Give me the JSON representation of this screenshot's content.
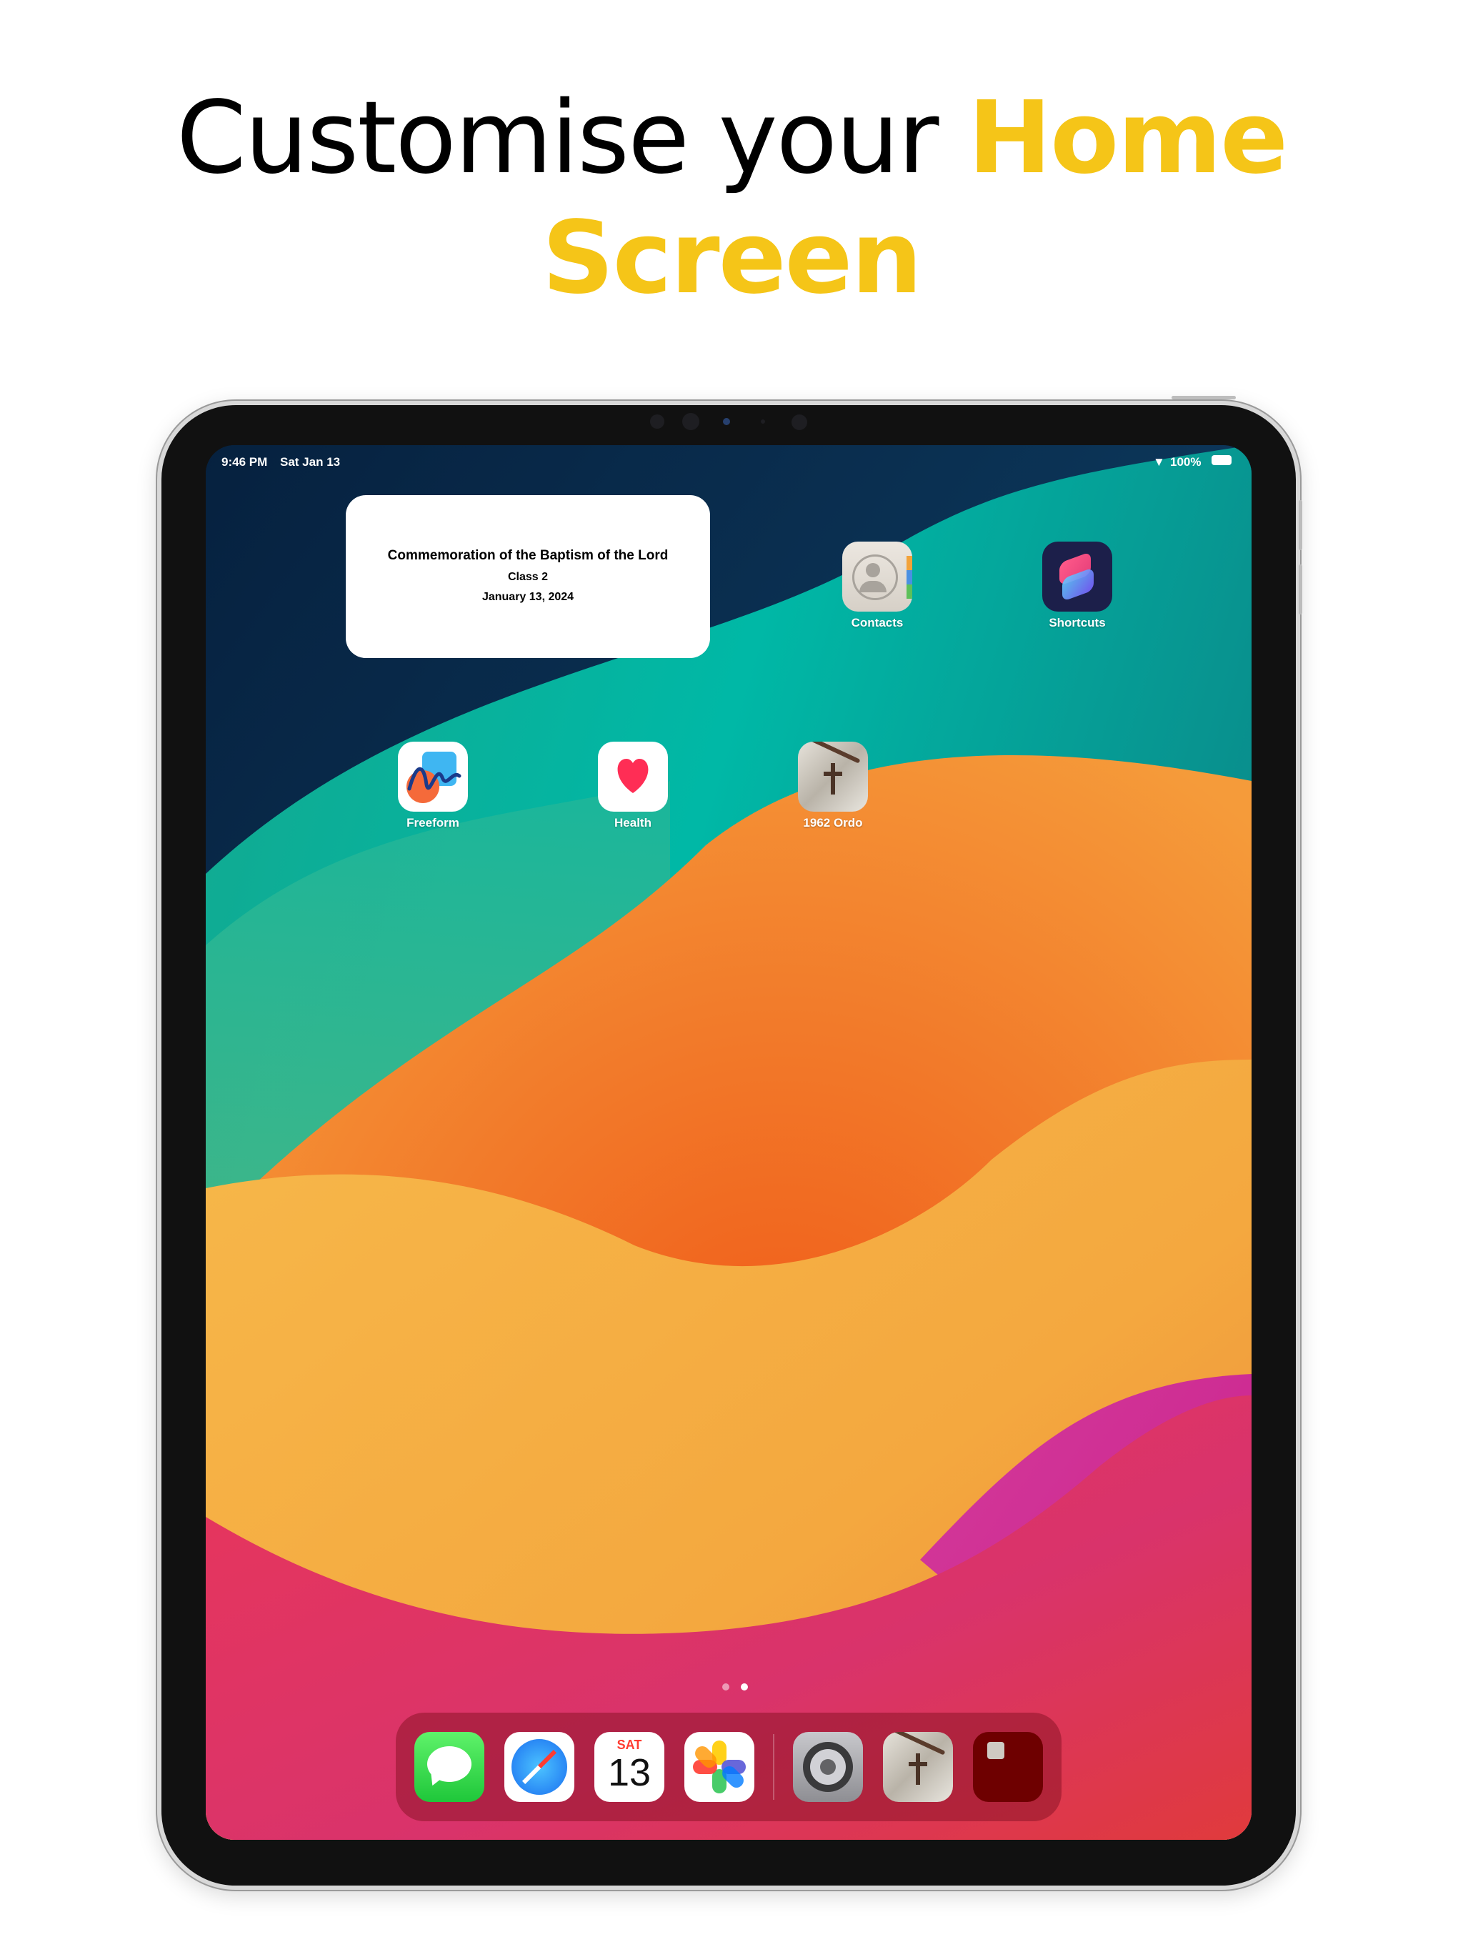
{
  "headline": {
    "part1": "Customise your ",
    "part2": "Home",
    "part3": "Screen"
  },
  "colors": {
    "accent": "#F5C518",
    "widget_bg": "#ffffff"
  },
  "status_bar": {
    "time": "9:46 PM",
    "date": "Sat Jan 13",
    "battery": "100%"
  },
  "widget": {
    "title": "Commemoration of the Baptism of the Lord",
    "class": "Class 2",
    "date": "January 13, 2024"
  },
  "apps": [
    {
      "label": "Contacts",
      "icon": "contacts-icon"
    },
    {
      "label": "Shortcuts",
      "icon": "shortcuts-icon"
    },
    {
      "label": "Freeform",
      "icon": "freeform-icon"
    },
    {
      "label": "Health",
      "icon": "health-icon"
    },
    {
      "label": "1962 Ordo",
      "icon": "ordo-icon"
    }
  ],
  "page_dots": {
    "count": 2,
    "active": 2
  },
  "dock": {
    "calendar_day": "SAT",
    "calendar_date": "13",
    "items": [
      "messages-icon",
      "safari-icon",
      "calendar-icon",
      "photos-icon",
      "settings-icon",
      "ordo-icon",
      "ordo-red-icon"
    ]
  }
}
